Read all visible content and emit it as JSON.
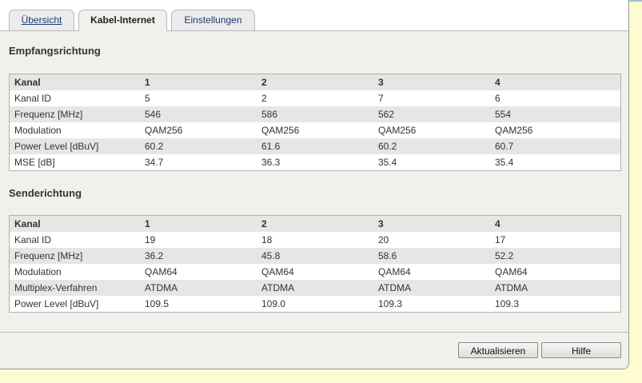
{
  "tabs": [
    {
      "label": "Übersicht"
    },
    {
      "label": "Kabel-Internet"
    },
    {
      "label": "Einstellungen"
    }
  ],
  "downstream": {
    "title": "Empfangsrichtung",
    "header": [
      "Kanal",
      "1",
      "2",
      "3",
      "4"
    ],
    "rows": [
      [
        "Kanal ID",
        "5",
        "2",
        "7",
        "6"
      ],
      [
        "Frequenz [MHz]",
        "546",
        "586",
        "562",
        "554"
      ],
      [
        "Modulation",
        "QAM256",
        "QAM256",
        "QAM256",
        "QAM256"
      ],
      [
        "Power Level [dBuV]",
        "60.2",
        "61.6",
        "60.2",
        "60.7"
      ],
      [
        "MSE [dB]",
        "34.7",
        "36.3",
        "35.4",
        "35.4"
      ]
    ]
  },
  "upstream": {
    "title": "Senderichtung",
    "header": [
      "Kanal",
      "1",
      "2",
      "3",
      "4"
    ],
    "rows": [
      [
        "Kanal ID",
        "19",
        "18",
        "20",
        "17"
      ],
      [
        "Frequenz [MHz]",
        "36.2",
        "45.8",
        "58.6",
        "52.2"
      ],
      [
        "Modulation",
        "QAM64",
        "QAM64",
        "QAM64",
        "QAM64"
      ],
      [
        "Multiplex-Verfahren",
        "ATDMA",
        "ATDMA",
        "ATDMA",
        "ATDMA"
      ],
      [
        "Power Level [dBuV]",
        "109.5",
        "109.0",
        "109.3",
        "109.3"
      ]
    ]
  },
  "buttons": {
    "refresh": "Aktualisieren",
    "help": "Hilfe"
  }
}
